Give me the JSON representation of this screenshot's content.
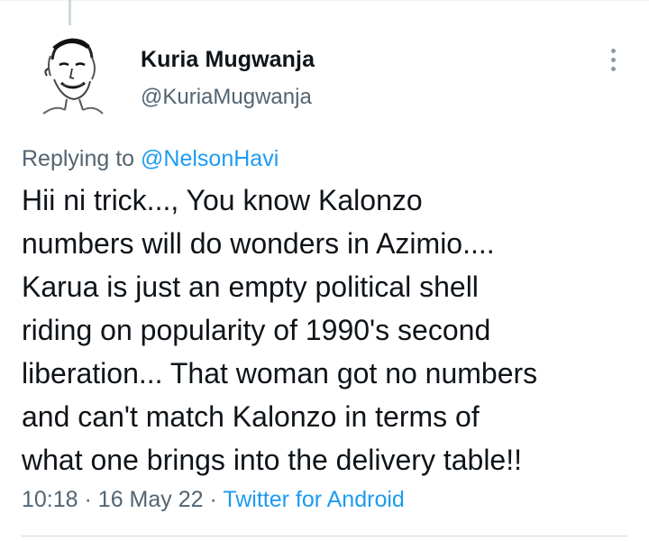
{
  "tweet": {
    "author": {
      "name": "Kuria Mugwanja",
      "handle": "@KuriaMugwanja"
    },
    "replying_prefix": "Replying to",
    "replying_to": "@NelsonHavi",
    "text_lines": [
      "Hii ni trick..., You know Kalonzo",
      "numbers will do wonders in Azimio....",
      "Karua is just an empty political shell",
      "riding on popularity of 1990's second",
      "liberation... That woman got no numbers",
      "and can't match Kalonzo in terms of",
      "what one brings into the delivery table!!"
    ],
    "time": "10:18",
    "date": "16 May 22",
    "source": "Twitter for Android",
    "separator": "·"
  },
  "icons": {
    "more": "more-vertical-icon",
    "avatar": "avatar-sketch"
  },
  "colors": {
    "link": "#1d9bf0",
    "secondary_text": "#536471",
    "primary_text": "#0f1419"
  }
}
